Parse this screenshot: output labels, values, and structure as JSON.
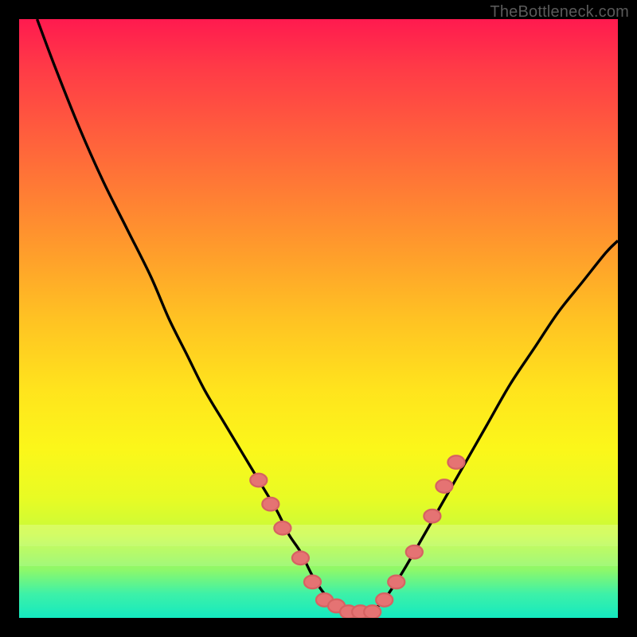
{
  "attribution": "TheBottleneck.com",
  "colors": {
    "frame": "#000000",
    "curve_stroke": "#000000",
    "dot_fill": "#e57373",
    "gradient_top": "#ff1a4f",
    "gradient_bottom": "#14e9c0"
  },
  "chart_data": {
    "type": "line",
    "title": "",
    "xlabel": "",
    "ylabel": "",
    "xlim": [
      0,
      100
    ],
    "ylim": [
      0,
      100
    ],
    "series": [
      {
        "name": "curve",
        "x": [
          3,
          6,
          10,
          14,
          18,
          22,
          25,
          28,
          31,
          34,
          37,
          40,
          43,
          45,
          47,
          49,
          51,
          53,
          55,
          57,
          60,
          63,
          66,
          70,
          74,
          78,
          82,
          86,
          90,
          94,
          98,
          100
        ],
        "y": [
          100,
          92,
          82,
          73,
          65,
          57,
          50,
          44,
          38,
          33,
          28,
          23,
          18,
          14,
          11,
          7,
          4,
          2,
          1,
          1,
          2,
          6,
          11,
          18,
          25,
          32,
          39,
          45,
          51,
          56,
          61,
          63
        ]
      }
    ],
    "markers": {
      "name": "dots",
      "x": [
        40,
        42,
        44,
        47,
        49,
        51,
        53,
        55,
        57,
        59,
        61,
        63,
        66,
        69,
        71,
        73
      ],
      "y": [
        23,
        19,
        15,
        10,
        6,
        3,
        2,
        1,
        1,
        1,
        3,
        6,
        11,
        17,
        22,
        26
      ]
    },
    "bands": [
      {
        "y_from": 84.5,
        "y_to": 88.0,
        "alpha": 0.22
      },
      {
        "y_from": 88.0,
        "y_to": 91.3,
        "alpha": 0.14
      }
    ]
  }
}
